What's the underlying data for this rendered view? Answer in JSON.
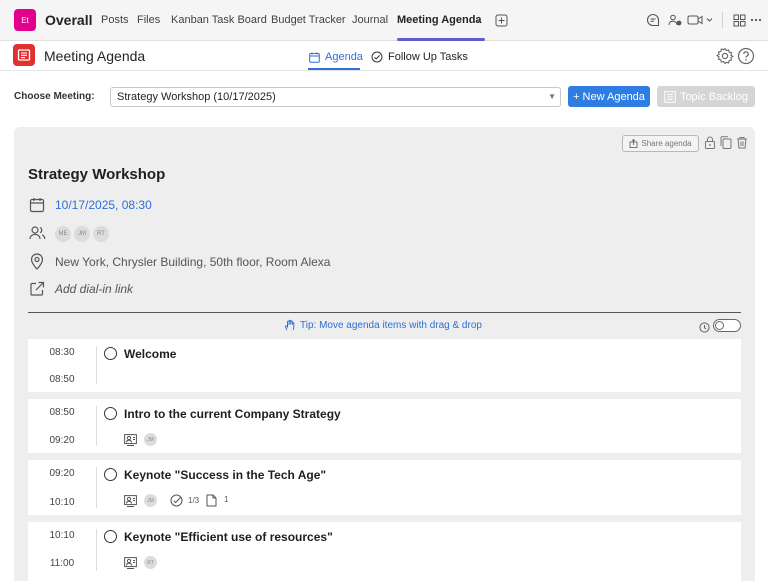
{
  "topbar": {
    "app_tile": "Et",
    "team": "Overall",
    "tabs": [
      "Posts",
      "Files",
      "Kanban Task Board",
      "Budget Tracker",
      "Journal",
      "Meeting Agenda"
    ]
  },
  "app": {
    "title": "Meeting Agenda",
    "tabs": {
      "agenda": "Agenda",
      "follow_up": "Follow Up Tasks"
    }
  },
  "chooser": {
    "label": "Choose Meeting:",
    "selected": "Strategy Workshop (10/17/2025)",
    "new_button": "+ New Agenda",
    "backlog_button": "Topic Backlog"
  },
  "meeting": {
    "share": "Share agenda",
    "title": "Strategy Workshop",
    "datetime": "10/17/2025, 08:30",
    "attendees": [
      "ME",
      "JM",
      "RT"
    ],
    "location": "New York, Chrysler Building, 50th floor, Room Alexa",
    "dial_in": "Add dial-in link",
    "tip": "Tip: Move agenda items with drag & drop"
  },
  "items": [
    {
      "start": "08:30",
      "end": "08:50",
      "title": "Welcome"
    },
    {
      "start": "08:50",
      "end": "09:20",
      "title": "Intro to the current Company Strategy",
      "presenter": "JM"
    },
    {
      "start": "09:20",
      "end": "10:10",
      "title": "Keynote \"Success in the Tech Age\"",
      "presenter": "JM",
      "tasks": "1/3",
      "docs": "1"
    },
    {
      "start": "10:10",
      "end": "11:00",
      "title": "Keynote \"Efficient use of resources\"",
      "presenter": "RT"
    }
  ],
  "colors": {
    "accent": "#2f7de1",
    "teams": "#5b5fc7",
    "app_logo": "#e03131"
  }
}
